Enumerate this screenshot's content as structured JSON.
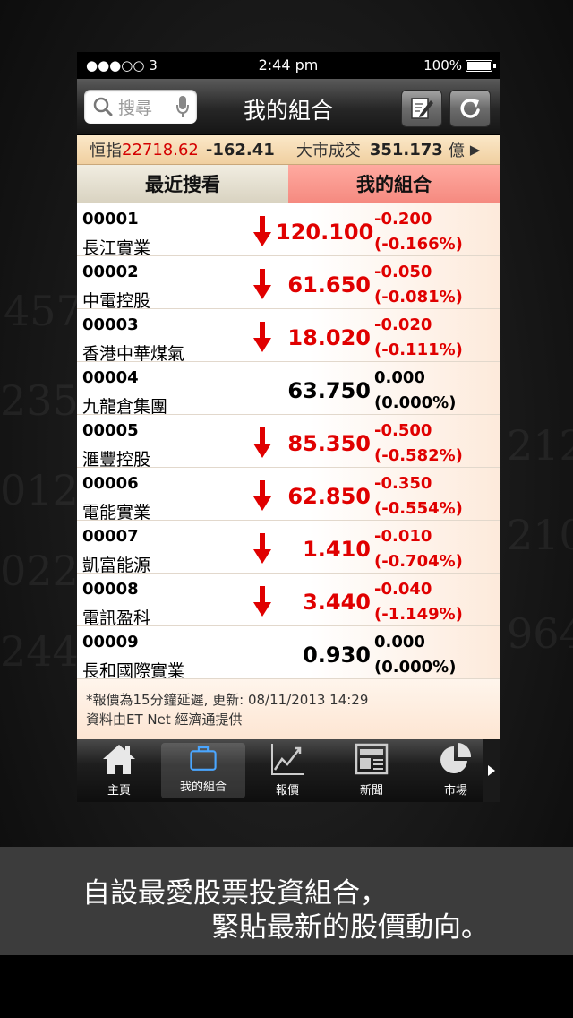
{
  "status_bar": {
    "carrier": "●●●○○ 3",
    "time": "2:44 pm",
    "battery": "100%"
  },
  "nav": {
    "search_placeholder": "搜尋",
    "title": "我的組合"
  },
  "ticker": {
    "index_label": "恒指",
    "index_value": "22718.62",
    "index_change": "-162.41",
    "turnover_label": "大市成交",
    "turnover_value": "351.173",
    "turnover_unit": "億",
    "more": "▶"
  },
  "tabs": {
    "recent": "最近搜看",
    "portfolio": "我的組合"
  },
  "stocks": [
    {
      "code": "00001",
      "name": "長江實業",
      "price": "120.100",
      "change": "-0.200",
      "pct": "(-0.166%)",
      "dir": "down"
    },
    {
      "code": "00002",
      "name": "中電控股",
      "price": "61.650",
      "change": "-0.050",
      "pct": "(-0.081%)",
      "dir": "down"
    },
    {
      "code": "00003",
      "name": "香港中華煤氣",
      "price": "18.020",
      "change": "-0.020",
      "pct": "(-0.111%)",
      "dir": "down"
    },
    {
      "code": "00004",
      "name": "九龍倉集團",
      "price": "63.750",
      "change": "0.000",
      "pct": "(0.000%)",
      "dir": "flat"
    },
    {
      "code": "00005",
      "name": "滙豐控股",
      "price": "85.350",
      "change": "-0.500",
      "pct": "(-0.582%)",
      "dir": "down"
    },
    {
      "code": "00006",
      "name": "電能實業",
      "price": "62.850",
      "change": "-0.350",
      "pct": "(-0.554%)",
      "dir": "down"
    },
    {
      "code": "00007",
      "name": "凱富能源",
      "price": "1.410",
      "change": "-0.010",
      "pct": "(-0.704%)",
      "dir": "down"
    },
    {
      "code": "00008",
      "name": "電訊盈科",
      "price": "3.440",
      "change": "-0.040",
      "pct": "(-1.149%)",
      "dir": "down"
    },
    {
      "code": "00009",
      "name": "長和國際實業",
      "price": "0.930",
      "change": "0.000",
      "pct": "(0.000%)",
      "dir": "flat"
    }
  ],
  "footnote": {
    "line1": "*報價為15分鐘延遲, 更新: 08/11/2013 14:29",
    "line2": "資料由ET Net 經濟通提供"
  },
  "tabbar": [
    {
      "label": "主頁",
      "icon": "home-icon"
    },
    {
      "label": "我的組合",
      "icon": "briefcase-icon"
    },
    {
      "label": "報價",
      "icon": "chart-line-icon"
    },
    {
      "label": "新聞",
      "icon": "newspaper-icon"
    },
    {
      "label": "市場",
      "icon": "pie-chart-icon"
    }
  ],
  "caption": {
    "line1": "自設最愛股票投資組合，",
    "line2": "緊貼最新的股價動向。"
  },
  "colors": {
    "down": "#e00000",
    "active_tab": "#f58a80",
    "ticker_bg": "#fbe8c8"
  }
}
